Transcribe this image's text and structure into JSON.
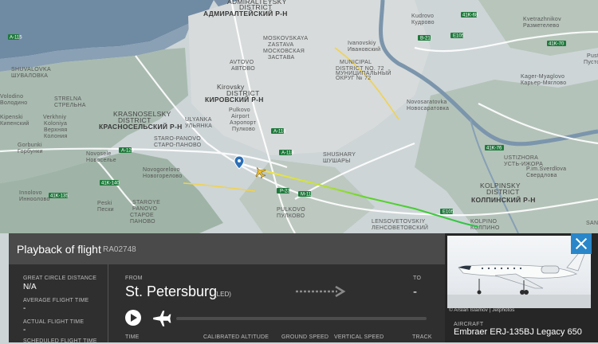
{
  "map": {
    "labels": [
      "ADMIRALTEYSKY",
      "DISTRICT",
      "АДМИРАЛТЕЙСКИЙ Р-Н",
      "Kudrovo",
      "Кудрово",
      "Kvetrazhnikov",
      "Разметелево",
      "MOSKOVSKAYA",
      "ZASTAVA",
      "МОСКОВСКАЯ",
      "ЗАСТАВА",
      "Ivanovskiy",
      "Ивановский",
      "AVTOVO",
      "АВТОВО",
      "MUNICIPAL",
      "DISTRICT NO. 72",
      "МУНИЦИПАЛЬНЫЙ",
      "ОКРУГ № 72",
      "Kager-Myaglovo",
      "Карьер-Мяглово",
      "Pust",
      "Пусто",
      "Kirovsky",
      "DISTRICT",
      "КИРОВСКИЙ Р-Н",
      "Novosaratovka",
      "Новосаратовка",
      "KRASNOSELSKY",
      "DISTRICT",
      "КРАСНОСЕЛЬСКИЙ Р-Н",
      "ULYANKA",
      "УЛЬЯНКА",
      "Pulkovo",
      "Airport",
      "Аэропорт",
      "Пулково",
      "Verkhniy",
      "Koloniya",
      "Верхняя",
      "Колония",
      "STARO-PANOVO",
      "СТАРО-ПАНОВО",
      "Gorbunki",
      "Горбунки",
      "Novosele",
      "Новоселье",
      "SHUSHARY",
      "ШУШАРЫ",
      "USTIZHORA",
      "УСТЬ-ИЖОРА",
      "P.im.Sverdlova",
      "Свердлова",
      "Novogorelovo",
      "Новогорелово",
      "KOLPINSKY",
      "DISTRICT",
      "КОЛПИНСКИЙ Р-Н",
      "Innolovo",
      "Инноолово",
      "Peski",
      "Пески",
      "STAROYE",
      "PANOVO",
      "СТАРОЕ",
      "ПАНОВО",
      "PULKOVO",
      "ПУЛКОВО",
      "LENSOVETOVSKIY",
      "ЛЕНСОВЕТОВСКИЙ",
      "KOLPINO",
      "КОЛПИНО",
      "SHUVALOVKA",
      "ШУВАЛОВКА",
      "STRELNA",
      "СТРЕЛЬНА",
      "Volodino",
      "Володино",
      "Kipenski",
      "Кипенский",
      "SANT"
    ],
    "roads": [
      "E105",
      "A-118",
      "E20",
      "A-120",
      "41K-76",
      "41K-68",
      "A-181",
      "A-115",
      "M-11",
      "41K-140",
      "E18",
      "M-10",
      "B-21",
      "41K-70"
    ]
  },
  "playback": {
    "title": "Playback of flight",
    "registration": "RA02748",
    "close_icon": "close-icon"
  },
  "stats": {
    "gcd_label": "GREAT CIRCLE DISTANCE",
    "gcd_value": "N/A",
    "avg_label": "AVERAGE FLIGHT TIME",
    "avg_value": "-",
    "actual_label": "ACTUAL FLIGHT TIME",
    "actual_value": "-",
    "next_label": "SCHEDULED FLIGHT TIME"
  },
  "route": {
    "from_label": "FROM",
    "from_city": "St. Petersburg",
    "from_code": "(LED)",
    "to_label": "TO",
    "to_value": "-",
    "headers": [
      "TIME",
      "CALIBRATED ALTITUDE",
      "GROUND SPEED",
      "VERTICAL SPEED",
      "TRACK"
    ]
  },
  "aircraft": {
    "photo_credit": "© Arslan Islamov | Jetphotos",
    "label": "AIRCRAFT",
    "value": "Embraer ERJ-135BJ Legacy 650"
  }
}
